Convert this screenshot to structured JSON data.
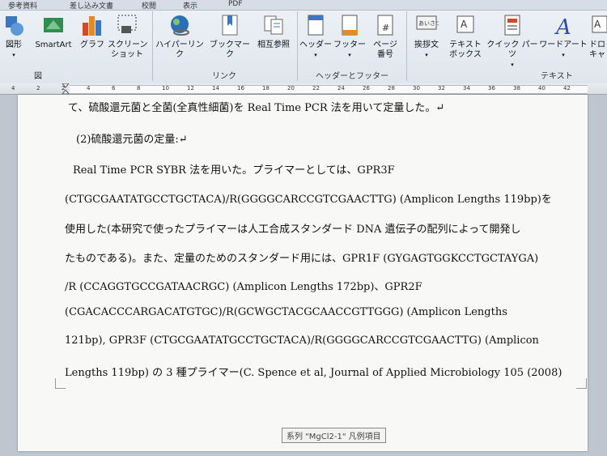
{
  "tabs": [
    "参考資料",
    "差し込み文書",
    "校閲",
    "表示",
    "PDF"
  ],
  "groups": {
    "illustrations": {
      "label": "図",
      "items": [
        {
          "label": "図形",
          "icon": "shapes-icon"
        },
        {
          "label": "SmartArt",
          "icon": "smartart-icon"
        },
        {
          "label": "グラフ",
          "icon": "chart-icon"
        },
        {
          "label": "スクリーン\nショット",
          "icon": "screenshot-icon"
        }
      ]
    },
    "links": {
      "label": "リンク",
      "items": [
        {
          "label": "ハイパーリンク",
          "icon": "hyperlink-icon"
        },
        {
          "label": "ブックマーク",
          "icon": "bookmark-icon"
        },
        {
          "label": "相互参照",
          "icon": "cross-reference-icon"
        }
      ]
    },
    "header_footer": {
      "label": "ヘッダーとフッター",
      "items": [
        {
          "label": "ヘッダー",
          "icon": "header-icon"
        },
        {
          "label": "フッター",
          "icon": "footer-icon"
        },
        {
          "label": "ページ\n番号",
          "icon": "page-number-icon"
        }
      ]
    },
    "text": {
      "label": "テキスト",
      "items": [
        {
          "label": "挨拶文",
          "icon": "greeting-icon"
        },
        {
          "label": "テキスト\nボックス",
          "icon": "textbox-icon"
        },
        {
          "label": "クイック パーツ",
          "icon": "quick-parts-icon"
        },
        {
          "label": "ワードアート",
          "icon": "wordart-icon"
        },
        {
          "label": "ドロ\nキャ",
          "icon": "dropcap-icon"
        }
      ]
    }
  },
  "ruler_ticks": [
    "4",
    "2",
    "2",
    "4",
    "6",
    "8",
    "10",
    "12",
    "14",
    "16",
    "18",
    "20",
    "22",
    "24",
    "26",
    "28",
    "30",
    "32",
    "34",
    "36",
    "38",
    "40",
    "42"
  ],
  "document": {
    "lines": [
      "て、硫酸還元菌と全菌(全真性細菌)を Real Time PCR 法を用いて定量した。↵",
      "(2)硫酸還元菌の定量:↵",
      "Real Time PCR SYBR 法を用いた。プライマーとしては、GPR3F",
      "(CTGCGAATATGCCTGCTACA)/R(GGGGCARCCGTCGAACTTG) (Amplicon Lengths 119bp)を",
      "使用した(本研究で使ったプライマーは人工合成スタンダード DNA 遺伝子の配列によって開発し",
      "たものである)。また、定量のためのスタンダード用には、GPR1F (GYGAGTGGKCCTGCTAYGA)",
      "/R (CCAGGTGCCGATAACRGC) (Amplicon Lengths 172bp)、GPR2F",
      "(CGACACCCARGACATGTGC)/R(GCWGCTACGCAACCGTTGGG) (Amplicon   Lengths",
      "121bp), GPR3F   (CTGCGAATATGCCTGCTACA)/R(GGGGCARCCGTCGAACTTG) (Amplicon",
      "Lengths 119bp) の 3 種プライマー(C. Spence et al, Journal of Applied Microbiology 105 (2008)"
    ]
  },
  "tooltip": "系列 \"MgCl2-1\" 凡例項目"
}
